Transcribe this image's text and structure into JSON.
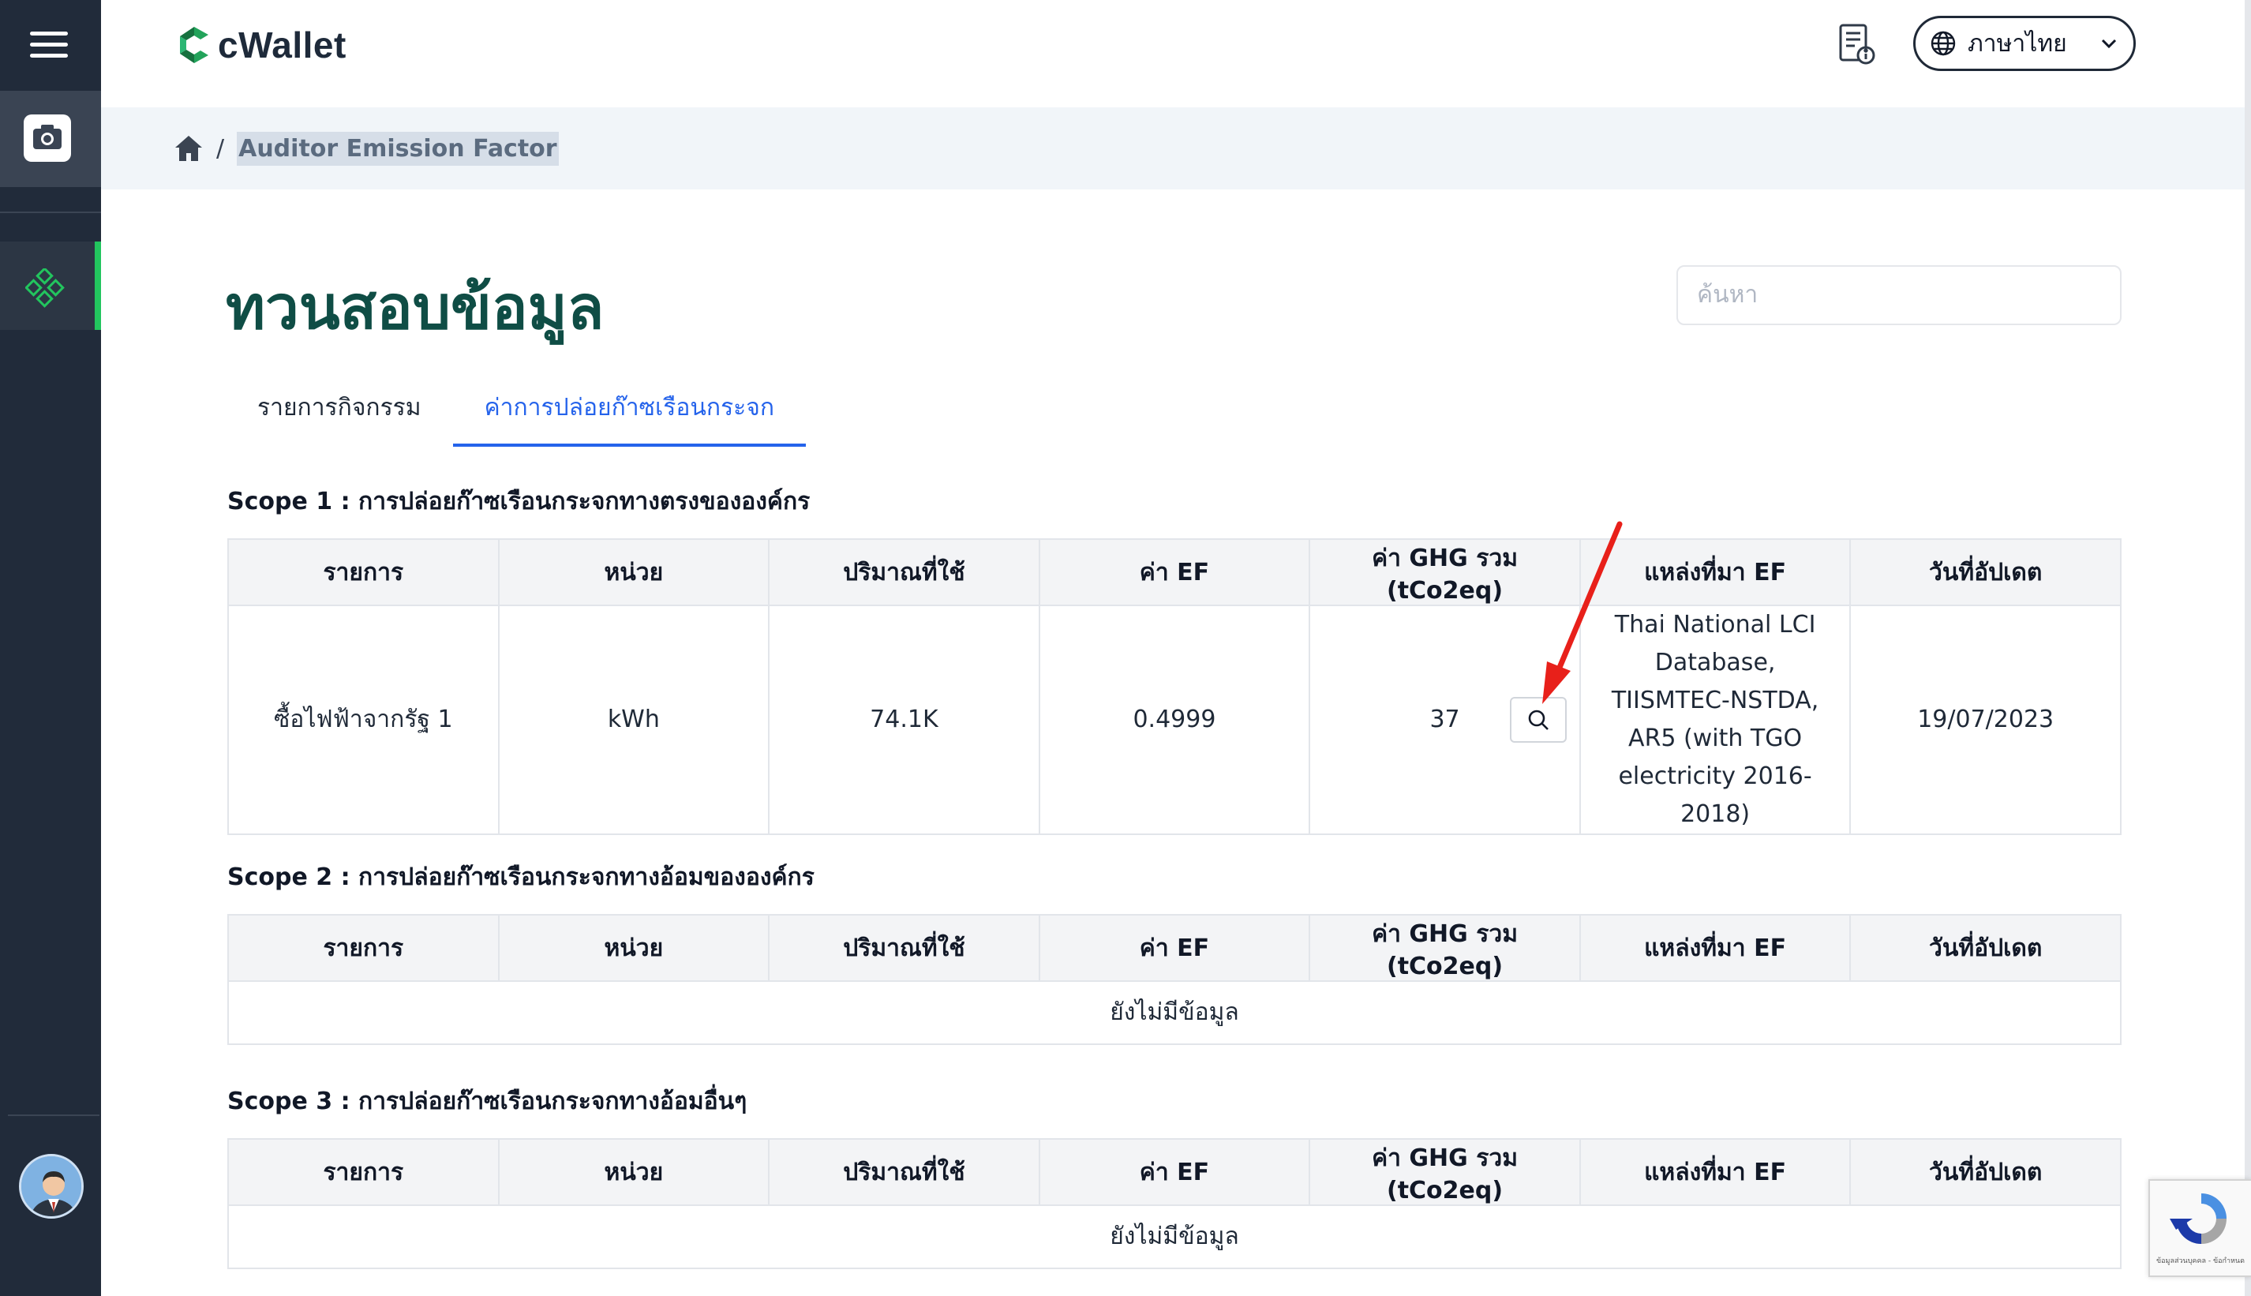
{
  "app": {
    "name": "cWallet"
  },
  "header": {
    "language": "ภาษาไทย"
  },
  "breadcrumb": {
    "current": "Auditor Emission Factor",
    "separator": "/"
  },
  "page": {
    "title": "ทวนสอบข้อมูล"
  },
  "search": {
    "placeholder": "ค้นหา"
  },
  "tabs": [
    {
      "label": "รายการกิจกรรม",
      "active": false
    },
    {
      "label": "ค่าการปล่อยก๊าซเรือนกระจก",
      "active": true
    }
  ],
  "table_headers": [
    "รายการ",
    "หน่วย",
    "ปริมาณที่ใช้",
    "ค่า EF",
    "ค่า GHG รวม (tCo2eq)",
    "แหล่งที่มา EF",
    "วันที่อัปเดต"
  ],
  "scopes": [
    {
      "title": "Scope 1 : การปล่อยก๊าซเรือนกระจกทางตรงขององค์กร",
      "rows": [
        {
          "item": "ซื้อไฟฟ้าจากรัฐ 1",
          "unit": "kWh",
          "quantity": "74.1K",
          "ef": "0.4999",
          "ghg": "37",
          "source": "Thai National LCI Database, TIISMTEC-NSTDA, AR5 (with TGO electricity 2016-2018)",
          "updated": "19/07/2023"
        }
      ]
    },
    {
      "title": "Scope 2 : การปล่อยก๊าซเรือนกระจกทางอ้อมขององค์กร",
      "empty_text": "ยังไม่มีข้อมูล"
    },
    {
      "title": "Scope 3 : การปล่อยก๊าซเรือนกระจกทางอ้อมอื่นๆ",
      "empty_text": "ยังไม่มีข้อมูล"
    }
  ],
  "recaptcha": {
    "footer": "ข้อมูลส่วนบุคคล - ข้อกำหนด"
  },
  "colors": {
    "sidebar": "#212b3a",
    "accent_green": "#22c55e",
    "title": "#0f4d45",
    "tab_active": "#2563eb",
    "annotation_arrow": "#e8201a"
  }
}
